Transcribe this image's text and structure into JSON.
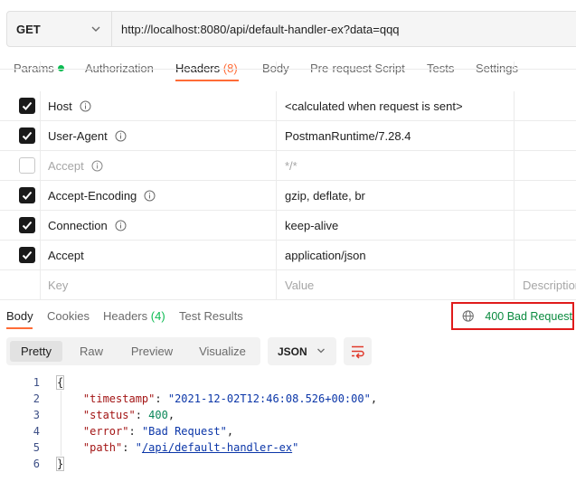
{
  "request": {
    "method": "GET",
    "url": "http://localhost:8080/api/default-handler-ex?data=qqq"
  },
  "request_tabs": [
    {
      "label": "Params",
      "count": "",
      "has_dot": true,
      "active": false
    },
    {
      "label": "Authorization",
      "count": "",
      "has_dot": false,
      "active": false
    },
    {
      "label": "Headers",
      "count": "(8)",
      "has_dot": false,
      "active": true
    },
    {
      "label": "Body",
      "count": "",
      "has_dot": false,
      "active": false
    },
    {
      "label": "Pre-request Script",
      "count": "",
      "has_dot": false,
      "active": false
    },
    {
      "label": "Tests",
      "count": "",
      "has_dot": false,
      "active": false
    },
    {
      "label": "Settings",
      "count": "",
      "has_dot": false,
      "active": false
    }
  ],
  "headers": [
    {
      "key": "Host",
      "value": "<calculated when request is sent>",
      "checked": true,
      "info": true
    },
    {
      "key": "User-Agent",
      "value": "PostmanRuntime/7.28.4",
      "checked": true,
      "info": true
    },
    {
      "key": "Accept",
      "value": "*/*",
      "checked": false,
      "info": true
    },
    {
      "key": "Accept-Encoding",
      "value": "gzip, deflate, br",
      "checked": true,
      "info": true
    },
    {
      "key": "Connection",
      "value": "keep-alive",
      "checked": true,
      "info": true
    },
    {
      "key": "Accept",
      "value": "application/json",
      "checked": true,
      "info": false
    }
  ],
  "headers_placeholder": {
    "key": "Key",
    "value": "Value",
    "description": "Description"
  },
  "response_tabs": [
    {
      "label": "Body",
      "count": "",
      "active": true
    },
    {
      "label": "Cookies",
      "count": "",
      "active": false
    },
    {
      "label": "Headers",
      "count": "(4)",
      "active": false
    },
    {
      "label": "Test Results",
      "count": "",
      "active": false
    }
  ],
  "status": "400 Bad Request",
  "view_modes": [
    "Pretty",
    "Raw",
    "Preview",
    "Visualize"
  ],
  "active_view": "Pretty",
  "format": "JSON",
  "response_body": {
    "timestamp": "2021-12-02T12:46:08.526+00:00",
    "status": "400",
    "error": "Bad Request",
    "path": "/api/default-handler-ex"
  },
  "line_numbers": [
    "1",
    "2",
    "3",
    "4",
    "5",
    "6"
  ],
  "colors": {
    "accent": "#ff6c37",
    "success": "#0cbb52",
    "status_box": "#e01b1b"
  }
}
